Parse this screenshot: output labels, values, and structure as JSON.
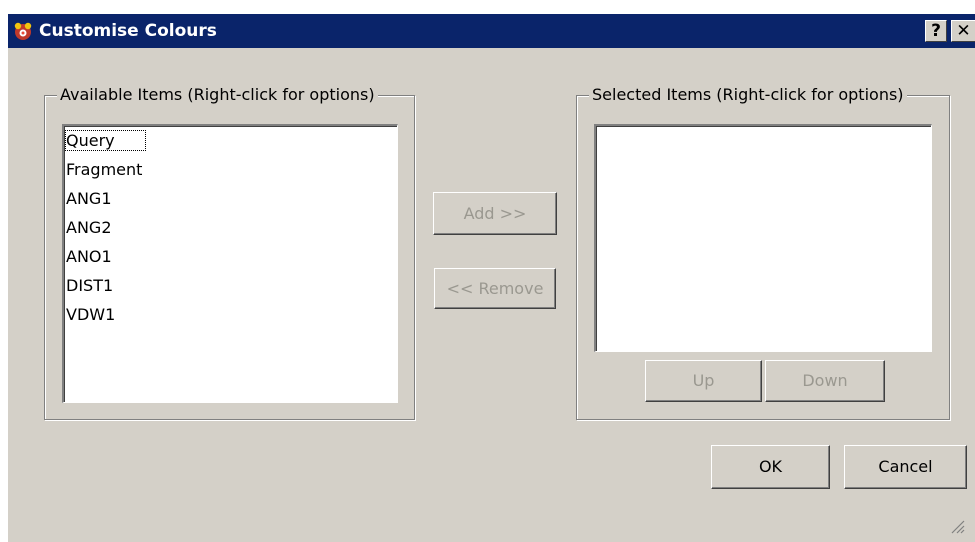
{
  "window": {
    "title": "Customise Colours",
    "help_label": "?",
    "close_label": "✕"
  },
  "available": {
    "group_label": "Available Items (Right-click for options)",
    "items": [
      "Query",
      "Fragment",
      "ANG1",
      "ANG2",
      "ANO1",
      "DIST1",
      "VDW1"
    ]
  },
  "selected": {
    "group_label": "Selected Items (Right-click for options)",
    "items": []
  },
  "buttons": {
    "add": "Add >>",
    "remove": "<< Remove",
    "up": "Up",
    "down": "Down",
    "ok": "OK",
    "cancel": "Cancel"
  },
  "colors": {
    "title_bar": "#0a246a",
    "window_bg": "#d4d0c8",
    "disabled_text": "#9a9890"
  }
}
